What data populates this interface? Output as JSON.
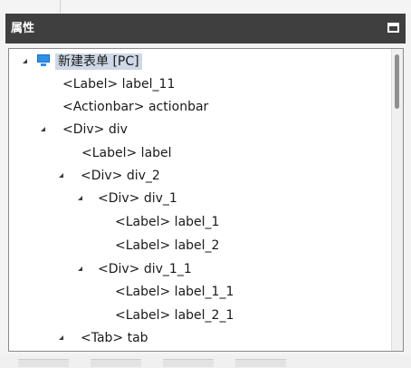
{
  "panel": {
    "title": "属性",
    "maximize_icon": "maximize-icon"
  },
  "tree": {
    "root": {
      "label": "新建表单 [PC]",
      "icon": "form-icon",
      "selected": true
    },
    "nodes": [
      {
        "label": "<Label> label_11"
      },
      {
        "label": "<Actionbar> actionbar"
      },
      {
        "label": "<Div> div",
        "expanded": true
      },
      {
        "label": "<Label> label"
      },
      {
        "label": "<Div> div_2",
        "expanded": true
      },
      {
        "label": "<Div> div_1",
        "expanded": true
      },
      {
        "label": "<Label> label_1"
      },
      {
        "label": "<Label> label_2"
      },
      {
        "label": "<Div> div_1_1",
        "expanded": true
      },
      {
        "label": "<Label> label_1_1"
      },
      {
        "label": "<Label> label_2_1"
      },
      {
        "label": "<Tab> tab",
        "expanded": true
      }
    ]
  },
  "colors": {
    "header_bg": "#3f3f3f",
    "selection_bg": "#cfd8e6",
    "icon_blue": "#2f8fe8"
  }
}
